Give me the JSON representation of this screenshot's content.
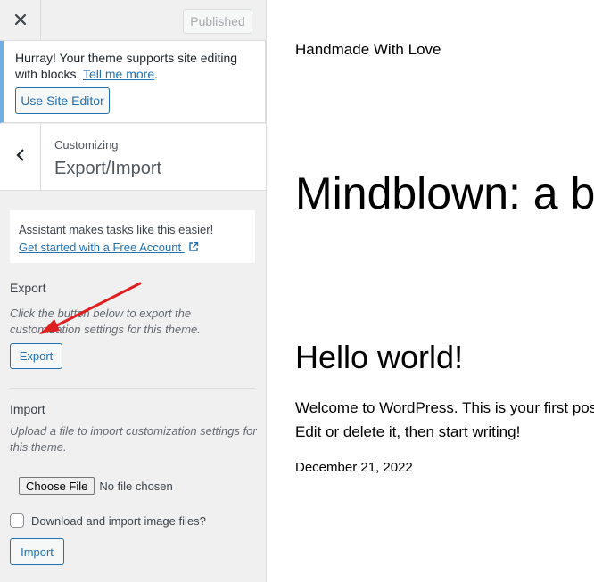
{
  "header": {
    "close_icon": "close-icon",
    "published_label": "Published"
  },
  "notice": {
    "text_before": "Hurray! Your theme supports site editing with blocks. ",
    "link_label": "Tell me more",
    "text_after": ".",
    "button_label": "Use Site Editor"
  },
  "section": {
    "back_icon": "chevron-left-icon",
    "customizing_label": "Customizing",
    "title": "Export/Import"
  },
  "assistant": {
    "text": "Assistant makes tasks like this easier!",
    "link_label": "Get started with a Free Account",
    "link_icon": "external-link-icon"
  },
  "export": {
    "heading": "Export",
    "description": "Click the button below to export the customization settings for this theme.",
    "button_label": "Export"
  },
  "import": {
    "heading": "Import",
    "description": "Upload a file to import customization settings for this theme.",
    "choose_file_label": "Choose File",
    "no_file_text": "No file chosen",
    "checkbox_label": "Download and import image files?",
    "button_label": "Import"
  },
  "annotation": {
    "arrow_color": "#e02020"
  },
  "preview": {
    "site_title": "Handmade With Love",
    "hero_text": "Mindblown: a b",
    "post_title": "Hello world!",
    "post_body": "Welcome to WordPress. This is your first post. Edit or delete it, then start writing!",
    "post_date": "December 21, 2022"
  }
}
